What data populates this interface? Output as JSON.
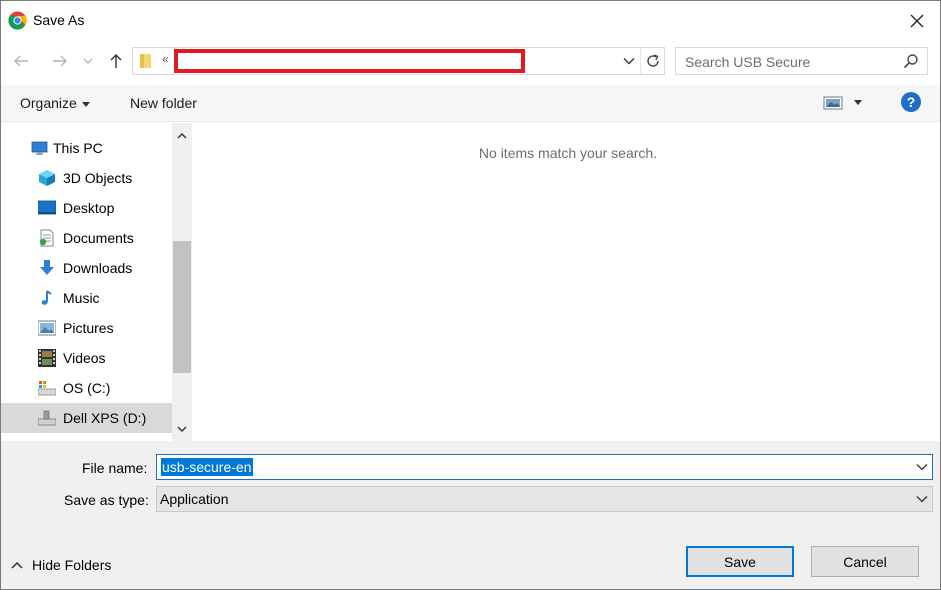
{
  "window": {
    "title": "Save As",
    "app_icon": "chrome-icon"
  },
  "nav": {
    "back_icon": "arrow-left-icon",
    "forward_icon": "arrow-right-icon",
    "recent_icon": "chevron-down-icon",
    "up_icon": "arrow-up-icon",
    "address_prefix": "«",
    "search_placeholder": "Search USB Secure"
  },
  "toolbar": {
    "organize_label": "Organize",
    "new_folder_label": "New folder",
    "help_label": "?"
  },
  "tree": {
    "items": [
      {
        "label": "This PC",
        "icon": "computer-icon"
      },
      {
        "label": "3D Objects",
        "icon": "cube-icon"
      },
      {
        "label": "Desktop",
        "icon": "desktop-icon"
      },
      {
        "label": "Documents",
        "icon": "document-icon"
      },
      {
        "label": "Downloads",
        "icon": "download-arrow-icon"
      },
      {
        "label": "Music",
        "icon": "music-note-icon"
      },
      {
        "label": "Pictures",
        "icon": "picture-icon"
      },
      {
        "label": "Videos",
        "icon": "film-icon"
      },
      {
        "label": "OS (C:)",
        "icon": "drive-icon"
      },
      {
        "label": "Dell XPS (D:)",
        "icon": "usb-drive-icon"
      }
    ]
  },
  "content": {
    "empty_message": "No items match your search."
  },
  "form": {
    "file_name_label": "File name:",
    "file_name_value": "usb-secure-en",
    "save_type_label": "Save as type:",
    "save_type_value": "Application"
  },
  "footer": {
    "hide_folders_label": "Hide Folders",
    "save_label": "Save",
    "cancel_label": "Cancel"
  },
  "colors": {
    "accent": "#0078d7",
    "redaction": "#e11a22",
    "help": "#1f6fc5"
  }
}
